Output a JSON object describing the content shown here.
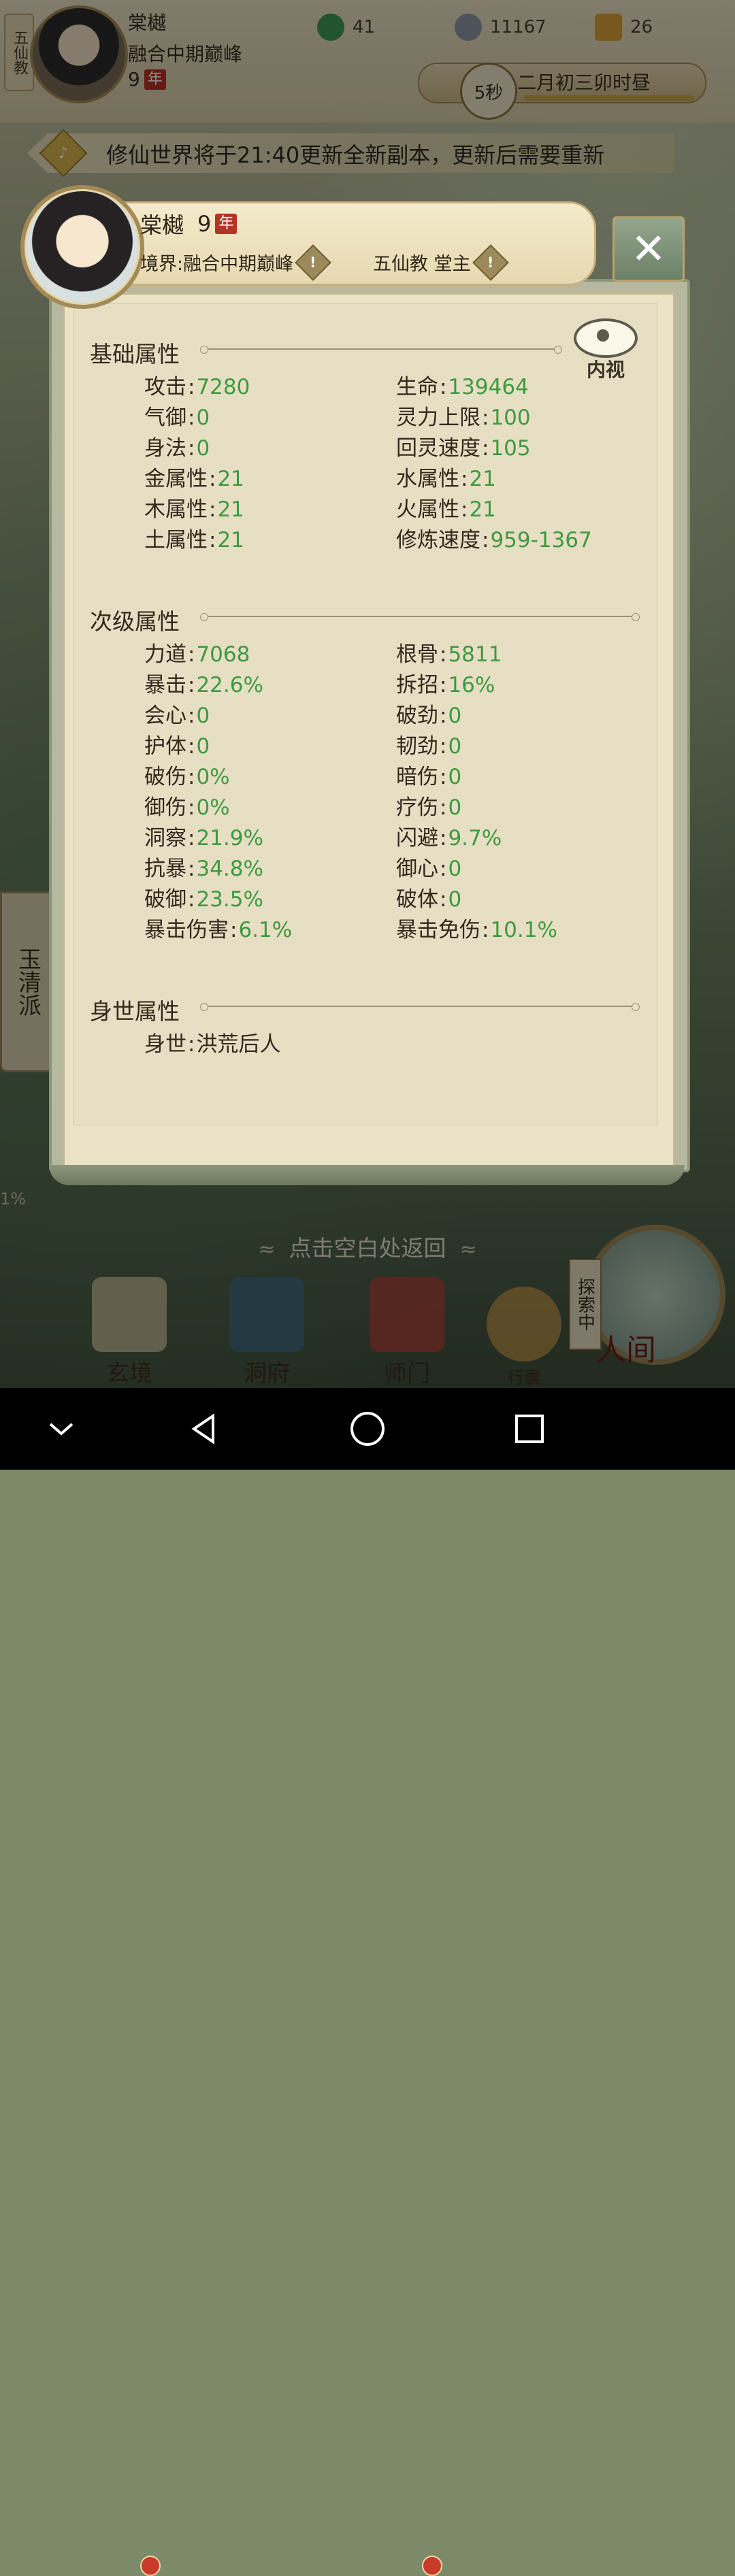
{
  "hud": {
    "sect_short": "五仙教",
    "name": "棠樾",
    "realm": "融合中期巅峰",
    "age": "9",
    "age_unit": "年",
    "resources": [
      {
        "icon": "jade-coin-icon",
        "value": "41"
      },
      {
        "icon": "spirit-stone-icon",
        "value": "11167"
      },
      {
        "icon": "trophy-icon",
        "value": "26"
      }
    ],
    "timer": "5秒",
    "date": "二月初三卯时昼"
  },
  "notice": {
    "text": "修仙世界将于21:40更新全新副本，更新后需要重新"
  },
  "sidebar": {
    "sect_banner": "玉清派",
    "percent": "1%"
  },
  "profile": {
    "name": "棠樾",
    "age": "9",
    "age_unit": "年",
    "realm_label": "境界:融合中期巅峰",
    "sect_label": "五仙教 堂主",
    "info_glyph": "!"
  },
  "eye_button": {
    "label": "内视"
  },
  "close_glyph": "✕",
  "sections": {
    "basic": {
      "title": "基础属性",
      "left": [
        {
          "label": "攻击",
          "value": "7280"
        },
        {
          "label": "气御",
          "value": "0"
        },
        {
          "label": "身法",
          "value": "0"
        },
        {
          "label": "金属性",
          "value": "21"
        },
        {
          "label": "木属性",
          "value": "21"
        },
        {
          "label": "土属性",
          "value": "21"
        }
      ],
      "right": [
        {
          "label": "生命",
          "value": "139464"
        },
        {
          "label": "灵力上限",
          "value": "100"
        },
        {
          "label": "回灵速度",
          "value": "105"
        },
        {
          "label": "水属性",
          "value": "21"
        },
        {
          "label": "火属性",
          "value": "21"
        },
        {
          "label": "修炼速度",
          "value": "959-1367"
        }
      ]
    },
    "secondary": {
      "title": "次级属性",
      "left": [
        {
          "label": "力道",
          "value": "7068"
        },
        {
          "label": "暴击",
          "value": "22.6%"
        },
        {
          "label": "会心",
          "value": "0"
        },
        {
          "label": "护体",
          "value": "0"
        },
        {
          "label": "破伤",
          "value": "0%"
        },
        {
          "label": "御伤",
          "value": "0%"
        },
        {
          "label": "洞察",
          "value": "21.9%"
        },
        {
          "label": "抗暴",
          "value": "34.8%"
        },
        {
          "label": "破御",
          "value": "23.5%"
        },
        {
          "label": "暴击伤害",
          "value": "6.1%"
        }
      ],
      "right": [
        {
          "label": "根骨",
          "value": "5811"
        },
        {
          "label": "拆招",
          "value": "16%"
        },
        {
          "label": "破劲",
          "value": "0"
        },
        {
          "label": "韧劲",
          "value": "0"
        },
        {
          "label": "暗伤",
          "value": "0"
        },
        {
          "label": "疗伤",
          "value": "0"
        },
        {
          "label": "闪避",
          "value": "9.7%"
        },
        {
          "label": "御心",
          "value": "0"
        },
        {
          "label": "破体",
          "value": "0"
        },
        {
          "label": "暴击免伤",
          "value": "10.1%"
        }
      ]
    },
    "background": {
      "title": "身世属性",
      "items": [
        {
          "label": "身世",
          "value": "洪荒后人"
        }
      ]
    }
  },
  "return_hint": "点击空白处返回",
  "bottom_nav": [
    {
      "label": "玄境",
      "badge": true
    },
    {
      "label": "洞府",
      "badge": false
    },
    {
      "label": "师门",
      "badge": true
    },
    {
      "label": "行囊",
      "badge": false
    }
  ],
  "world": {
    "label": "人间",
    "explore": "探索中"
  },
  "colors": {
    "value_green": "#3f9a3f",
    "seal_red": "#b63225"
  }
}
